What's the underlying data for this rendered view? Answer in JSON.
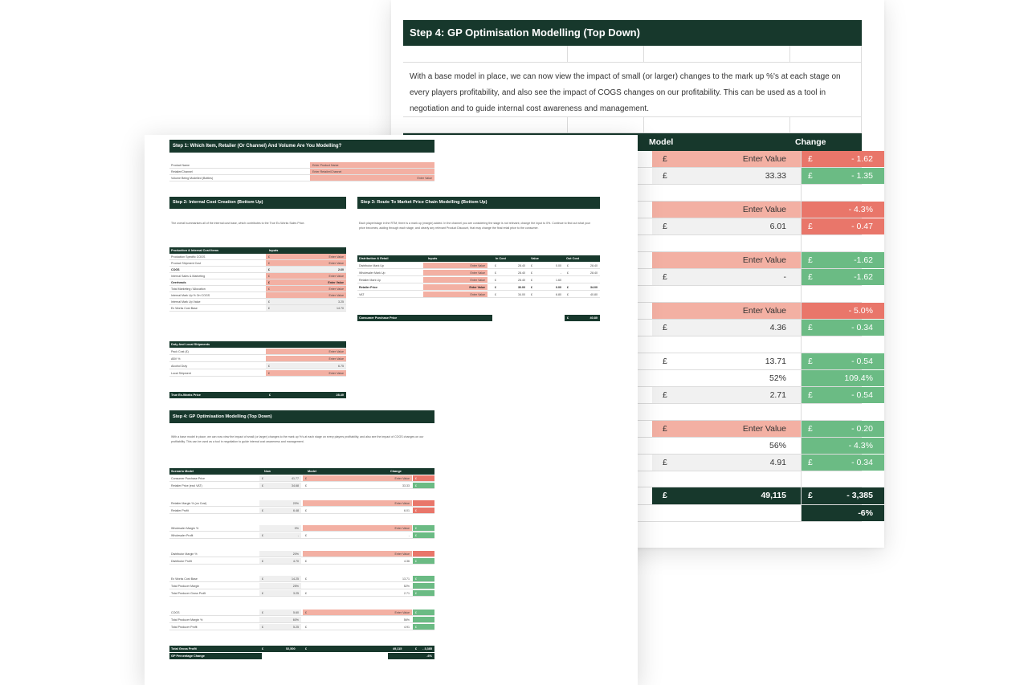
{
  "back_sheet": {
    "title": "Step 4: GP Optimisation Modelling (Top Down)",
    "paragraph": "With a base model in place, we can now view the impact of small (or larger) changes to the mark up %'s at each stage on every players profitability, and also see the impact of COGS changes on our profitability. This can be used as a tool in negotiation and to guide internal cost awareness and management.",
    "headers": {
      "model": "Model",
      "change": "Change"
    },
    "rows": [
      {
        "model_cur": "£",
        "model_val": "Enter Value",
        "change_cur": "£",
        "change_val": "- 1.62"
      },
      {
        "model_cur": "£",
        "model_val": "33.33",
        "change_cur": "£",
        "change_val": "- 1.35"
      },
      {
        "model_cur": "",
        "model_val": "Enter Value",
        "change_cur": "",
        "change_val": "- 4.3%"
      },
      {
        "model_cur": "£",
        "model_val": "6.01",
        "change_cur": "£",
        "change_val": "- 0.47"
      },
      {
        "model_cur": "",
        "model_val": "Enter Value",
        "change_cur": "£",
        "change_val": "-1.62"
      },
      {
        "model_cur": "£",
        "model_val": "-",
        "change_cur": "£",
        "change_val": "-1.62"
      },
      {
        "model_cur": "",
        "model_val": "Enter Value",
        "change_cur": "",
        "change_val": "- 5.0%"
      },
      {
        "model_cur": "£",
        "model_val": "4.36",
        "change_cur": "£",
        "change_val": "- 0.34"
      },
      {
        "model_cur": "£",
        "model_val": "13.71",
        "change_cur": "£",
        "change_val": "- 0.54"
      },
      {
        "model_cur": "",
        "model_val": "52%",
        "change_cur": "",
        "change_val": "109.4%"
      },
      {
        "model_cur": "£",
        "model_val": "2.71",
        "change_cur": "£",
        "change_val": "- 0.54"
      },
      {
        "model_cur": "£",
        "model_val": "Enter Value",
        "change_cur": "£",
        "change_val": "- 0.20"
      },
      {
        "model_cur": "",
        "model_val": "56%",
        "change_cur": "",
        "change_val": "- 4.3%"
      },
      {
        "model_cur": "£",
        "model_val": "4.91",
        "change_cur": "£",
        "change_val": "- 0.34"
      },
      {
        "model_cur": "£",
        "model_val": "49,115",
        "change_cur": "£",
        "change_val": "- 3,385"
      },
      {
        "model_cur": "",
        "model_val": "",
        "change_cur": "",
        "change_val": "-6%"
      }
    ],
    "colors": {
      "dark_green": "#17382c",
      "pink": "#f3b0a3",
      "red": "#e9766a",
      "green": "#6bbb84"
    }
  },
  "front_sheet": {
    "step1": {
      "title": "Step 1: Which Item, Retailer (Or Channel) And Volume Are You Modelling?",
      "rows": [
        {
          "label": "Product Name",
          "value": "Enter Product Name"
        },
        {
          "label": "Retailer/Channel",
          "value": "Enter Retailer/Channel"
        },
        {
          "label": "Volume Being Modelled (Bottles)",
          "value": "Enter Value"
        }
      ]
    },
    "step2": {
      "title": "Step 2: Internal Cost Creation (Bottom Up)",
      "intro": "The overall summarises all of the internal cost base, which contributes to the True Ex-Works Sales Price.",
      "table_header": {
        "label": "Production & Internal Cost Items",
        "inputs": "Inputs"
      },
      "rows": [
        {
          "label": "Production Specific COGS",
          "cur": "£",
          "value": "Enter Value"
        },
        {
          "label": "Product Shipment Cost",
          "cur": "£",
          "value": "Enter Value"
        },
        {
          "label": "COGS",
          "cur": "£",
          "value": "2.60"
        },
        {
          "label": "Internal Sales & Marketing",
          "cur": "£",
          "value": "Enter Value"
        },
        {
          "label": "Overheads",
          "cur": "£",
          "value": "Enter Value"
        },
        {
          "label": "Total Marketing / Allocation",
          "cur": "£",
          "value": "Enter Value"
        },
        {
          "label": "Internal Mark Up % On COGS",
          "cur": "",
          "value": "Enter Value"
        },
        {
          "label": "Internal Mark Up Value",
          "cur": "£",
          "value": "3.25"
        },
        {
          "label": "Ex Works Cost Base",
          "cur": "£",
          "value": "14.70"
        }
      ],
      "duty_header": "Duty And Local Shipments",
      "duty_rows": [
        {
          "label": "Pack Cost (£)",
          "cur": "",
          "value": "Enter Value"
        },
        {
          "label": "ABV %",
          "cur": "",
          "value": "Enter Value"
        },
        {
          "label": "Alcohol Duty",
          "cur": "£",
          "value": "6.75"
        },
        {
          "label": "Local Shipment",
          "cur": "£",
          "value": "Enter Value"
        }
      ],
      "footer": {
        "label": "True Ex-Works Price",
        "cur": "£",
        "value": "28.40"
      }
    },
    "step3": {
      "title": "Step 3: Route To Market Price Chain Modelling (Bottom Up)",
      "intro": "Each player/stage in the RTM, there is a mark up (margin) added. In the channel you are considering the stage is not relevant, change the input to 0%. Continue to find out what your price becomes, adding through each stage, and clearly any relevant Product Discount, that may change the final retail price to the consumer.",
      "headers": {
        "label": "Distribution & Retail",
        "inputs": "Inputs",
        "in_cost": "In Cost",
        "value": "Value",
        "out_cost": "Out Cost"
      },
      "rows": [
        {
          "label": "Distributor Mark Up",
          "input": "Enter Value",
          "in_cur": "£",
          "in": "28.40",
          "v_cur": "£",
          "val": "0.00",
          "o_cur": "£",
          "out": "28.40"
        },
        {
          "label": "Wholesaler Mark Up",
          "input": "Enter Value",
          "in_cur": "£",
          "in": "28.40",
          "v_cur": "£",
          "val": "-",
          "o_cur": "£",
          "out": "28.40"
        },
        {
          "label": "Retailer Mark Up",
          "input": "Enter Value",
          "in_cur": "£",
          "in": "28.40",
          "v_cur": "£",
          "val": "1.60",
          "o_cur": "",
          "out": ""
        },
        {
          "label": "Retailer Price",
          "input": "Enter Value",
          "in_cur": "£",
          "in": "30.00",
          "v_cur": "£",
          "val": "0.00",
          "o_cur": "£",
          "out": "34.00"
        },
        {
          "label": "VAT",
          "input": "Enter Value",
          "in_cur": "£",
          "in": "34.00",
          "v_cur": "£",
          "val": "6.80",
          "o_cur": "£",
          "out": "40.80"
        }
      ],
      "footer": {
        "label": "Consumer Purchase Price",
        "cur": "£",
        "value": "40.80"
      }
    },
    "step4": {
      "title": "Step 4: GP Optimisation Modelling (Top Down)",
      "intro": "With a base model in place, we can now view the impact of small (or larger) changes to the mark up %'s at each stage on every players profitability, and also see the impact of COGS changes on our profitability. This can be used as a tool in negotiation to guide internal cost awareness and management.",
      "headers": {
        "label": "Scenario Model",
        "now": "Now",
        "model": "Model",
        "change": "Change"
      },
      "groups": [
        [
          {
            "label": "Consumer Purchase Price",
            "now_cur": "£",
            "now": "41.77",
            "model_cur": "£",
            "model": "Enter Value",
            "change_cur": "£",
            "change": "- 1.62"
          },
          {
            "label": "Retailer Price (excl VAT)",
            "now_cur": "£",
            "now": "34.68",
            "model_cur": "£",
            "model": "33.33",
            "change_cur": "£",
            "change": "- 1.35"
          }
        ],
        [
          {
            "label": "Retailer Margin % (on Cost)",
            "now_cur": "",
            "now": "20%",
            "model_cur": "",
            "model": "Enter Value",
            "change_cur": "",
            "change": "- 4.3%"
          },
          {
            "label": "Retailer Profit",
            "now_cur": "£",
            "now": "6.48",
            "model_cur": "£",
            "model": "6.01",
            "change_cur": "£",
            "change": "- 0.47"
          }
        ],
        [
          {
            "label": "Wholesaler Margin %",
            "now_cur": "",
            "now": "0%",
            "model_cur": "",
            "model": "Enter Value",
            "change_cur": "£",
            "change": "- 1.62"
          },
          {
            "label": "Wholesaler Profit",
            "now_cur": "£",
            "now": "-",
            "model_cur": "£",
            "model": "-",
            "change_cur": "£",
            "change": "- 1.62"
          }
        ],
        [
          {
            "label": "Distributor Margin %",
            "now_cur": "",
            "now": "20%",
            "model_cur": "",
            "model": "Enter Value",
            "change_cur": "",
            "change": "- 5.0%"
          },
          {
            "label": "Distributor Profit",
            "now_cur": "£",
            "now": "4.70",
            "model_cur": "£",
            "model": "4.36",
            "change_cur": "£",
            "change": "- 0.34"
          }
        ],
        [
          {
            "label": "Ex Works Cost Base",
            "now_cur": "£",
            "now": "14.25",
            "model_cur": "£",
            "model": "13.71",
            "change_cur": "£",
            "change": "- 0.54"
          },
          {
            "label": "Total Producer Margin",
            "now_cur": "",
            "now": "25%",
            "model_cur": "",
            "model": "52%",
            "change_cur": "",
            "change": "109.4%"
          },
          {
            "label": "Total Producer Gross Profit",
            "now_cur": "£",
            "now": "3.25",
            "model_cur": "£",
            "model": "2.71",
            "change_cur": "£",
            "change": "- 0.54"
          }
        ],
        [
          {
            "label": "COGS",
            "now_cur": "£",
            "now": "5.60",
            "model_cur": "£",
            "model": "Enter Value",
            "change_cur": "£",
            "change": "- 0.20"
          },
          {
            "label": "Total Producer Margin %",
            "now_cur": "",
            "now": "60%",
            "model_cur": "",
            "model": "56%",
            "change_cur": "",
            "change": "- 4.3%"
          },
          {
            "label": "Total Producer Profit",
            "now_cur": "£",
            "now": "5.25",
            "model_cur": "£",
            "model": "4.91",
            "change_cur": "£",
            "change": "- 0.34"
          }
        ]
      ],
      "total_row": {
        "label": "Total Gross Profit",
        "now_cur": "£",
        "now": "52,500",
        "model_cur": "£",
        "model": "49,115",
        "change_cur": "£",
        "change": "- 3,385"
      },
      "pct_row": {
        "label": "GP Percentage Change",
        "change": "-6%"
      }
    }
  }
}
